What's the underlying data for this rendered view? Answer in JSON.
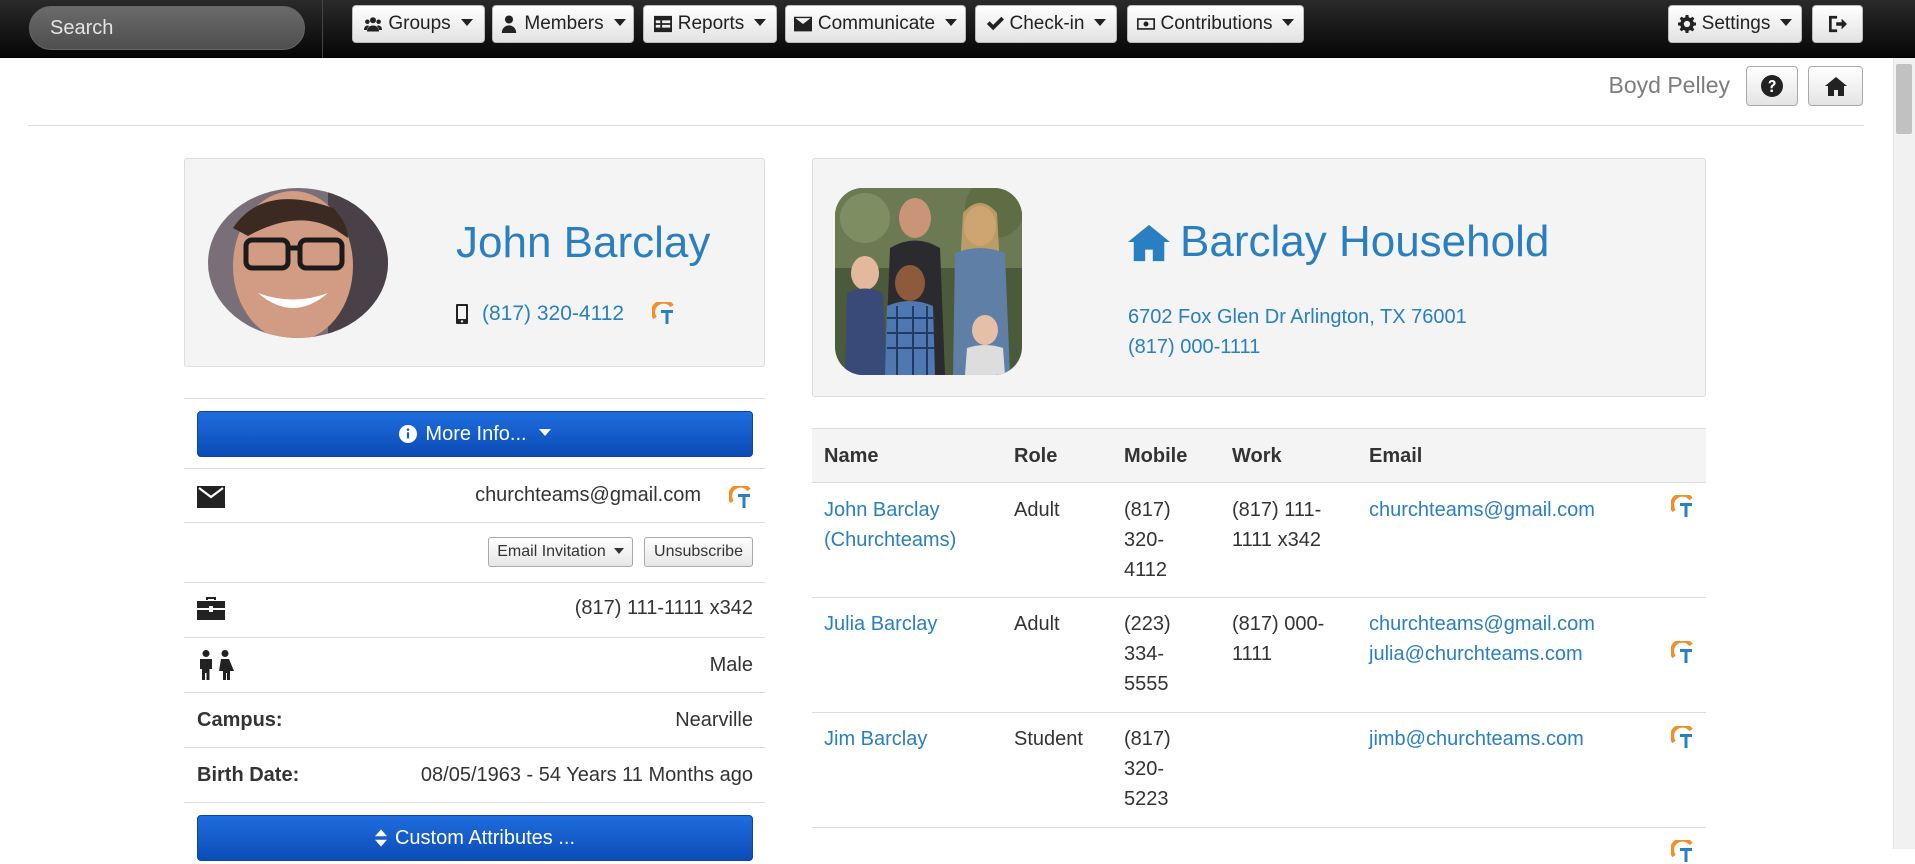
{
  "topbar": {
    "search_placeholder": "Search",
    "menus": [
      {
        "label": "Groups",
        "icon": "users-icon"
      },
      {
        "label": "Members",
        "icon": "user-icon"
      },
      {
        "label": "Reports",
        "icon": "table-icon"
      },
      {
        "label": "Communicate",
        "icon": "envelope-icon"
      },
      {
        "label": "Check-in",
        "icon": "check-icon"
      },
      {
        "label": "Contributions",
        "icon": "money-icon"
      }
    ],
    "settings_label": "Settings"
  },
  "header": {
    "user_name": "Boyd Pelley"
  },
  "person": {
    "name": "John Barclay",
    "mobile": "(817) 320-4112",
    "more_info_label": "More Info...",
    "email": "churchteams@gmail.com",
    "email_invitation_label": "Email Invitation",
    "unsubscribe_label": "Unsubscribe",
    "work_phone": "(817) 111-1111 x342",
    "gender": "Male",
    "campus_label": "Campus:",
    "campus": "Nearville",
    "birth_label": "Birth Date:",
    "birth_date": "08/05/1963 - 54 Years 11 Months ago",
    "custom_attributes_label": "Custom Attributes ..."
  },
  "household": {
    "title": "Barclay Household",
    "address": "6702 Fox Glen Dr Arlington, TX 76001",
    "phone": "(817) 000-1111",
    "columns": [
      "Name",
      "Role",
      "Mobile",
      "Work",
      "Email"
    ],
    "members": [
      {
        "name": [
          "John Barclay",
          "(Churchteams)"
        ],
        "role": "Adult",
        "mobile": [
          "(817)",
          "320-",
          "4112"
        ],
        "work": [
          "(817) 111-",
          "1111 x342"
        ],
        "email": [
          "churchteams@gmail.com"
        ]
      },
      {
        "name": [
          "Julia Barclay"
        ],
        "role": "Adult",
        "mobile": [
          "(223)",
          "334-",
          "5555"
        ],
        "work": [
          "(817) 000-",
          "1111"
        ],
        "email": [
          "churchteams@gmail.com",
          "julia@churchteams.com"
        ]
      },
      {
        "name": [
          "Jim Barclay"
        ],
        "role": "Student",
        "mobile": [
          "(817)",
          "320-",
          "5223"
        ],
        "work": [],
        "email": [
          "jimb@churchteams.com"
        ]
      }
    ]
  },
  "colors": {
    "link": "#2a7fc1",
    "primary_button": "#1560cc",
    "logo_orange": "#f0902b",
    "logo_blue": "#2a7fc1"
  }
}
